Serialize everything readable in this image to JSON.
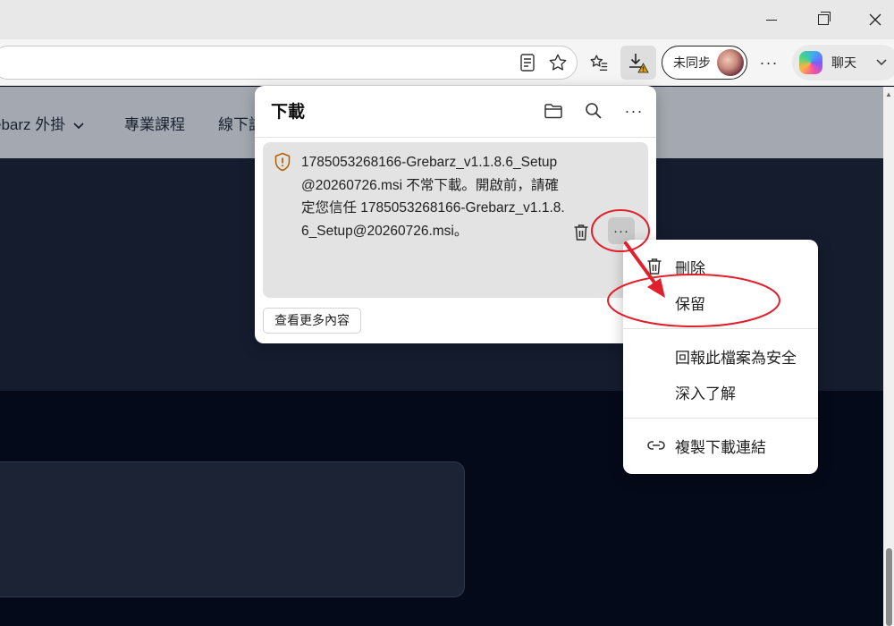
{
  "window": {
    "minimize_icon": "minimize-icon",
    "maximize_icon": "restore-icon",
    "close_icon": "close-icon"
  },
  "toolbar": {
    "sync_label": "未同步",
    "copilot_label": "聊天",
    "download_icon": "download-icon"
  },
  "page": {
    "nav": [
      "ebarz 外掛",
      "專業課程",
      "線下課"
    ],
    "colors": {
      "nav_bg": "#a4a9b1",
      "hero_bg": "#141c2e",
      "body_bg": "#050a1a"
    }
  },
  "downloads": {
    "title": "下載",
    "item_text": "1785053268166-Grebarz_v1.1.8.6_Setup@20260726.msi 不常下載。開啟前，請確定您信任 1785053268166-Grebarz_v1.1.8.6_Setup@20260726.msi。",
    "see_more": "查看更多內容",
    "warning_color": "#b35c00"
  },
  "context_menu": {
    "items": [
      {
        "label": "刪除",
        "icon": "trash-icon"
      },
      {
        "label": "保留",
        "icon": ""
      },
      {
        "label": "回報此檔案為安全",
        "icon": ""
      },
      {
        "label": "深入了解",
        "icon": ""
      },
      {
        "label": "複製下載連結",
        "icon": "link-icon"
      }
    ]
  },
  "annotation": {
    "color": "#e0202a"
  }
}
